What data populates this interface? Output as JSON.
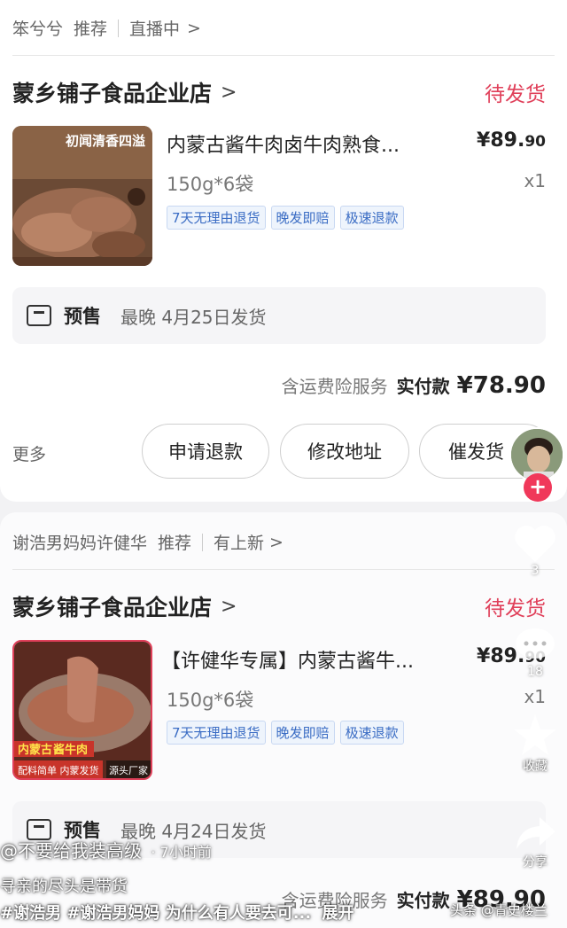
{
  "order1": {
    "source": {
      "author": "笨兮兮",
      "tag": "推荐",
      "live": "直播中",
      "chevron": ">"
    },
    "shop": {
      "name": "蒙乡铺子食品企业店",
      "chevron": ">",
      "status": "待发货"
    },
    "product": {
      "thumb_text": "初闻清香四溢",
      "name": "内蒙古酱牛肉卤牛肉熟食...",
      "price_main": "¥89.",
      "price_cents": "90",
      "spec": "150g*6袋",
      "qty": "x1",
      "tags": [
        "7天无理由退货",
        "晚发即赔",
        "极速退款"
      ]
    },
    "presale": {
      "title": "预售",
      "desc": "最晚 4月25日发货"
    },
    "total": {
      "insurance": "含运费险服务",
      "paid_label": "实付款",
      "amount": "¥78.90"
    },
    "actions": {
      "more": "更多",
      "refund": "申请退款",
      "edit_address": "修改地址",
      "urge": "催发货"
    }
  },
  "order2": {
    "source": {
      "author": "谢浩男妈妈许健华",
      "tag": "推荐",
      "new": "有上新",
      "chevron": ">"
    },
    "shop": {
      "name": "蒙乡铺子食品企业店",
      "chevron": ">",
      "status": "待发货"
    },
    "product": {
      "thumb_text_1": "内蒙古",
      "thumb_text_2": "酱牛肉",
      "thumb_text_3": "配料简单 内蒙发货",
      "thumb_text_4": "源头厂家",
      "name": "【许健华专属】内蒙古酱牛...",
      "price_main": "¥89.",
      "price_cents": "90",
      "spec": "150g*6袋",
      "qty": "x1",
      "tags": [
        "7天无理由退货",
        "晚发即赔",
        "极速退款"
      ]
    },
    "presale": {
      "title": "预售",
      "desc": "最晚 4月24日发货"
    },
    "total": {
      "insurance": "含运费险服务",
      "paid_label": "实付款",
      "amount": "¥89.90"
    }
  },
  "sidebar": {
    "like_count": "3",
    "comment_count": "18",
    "favorite_label": "收藏",
    "share_label": "分享"
  },
  "video_overlay": {
    "author": "@不要给我装高级",
    "time": "· 7小时前",
    "caption": "寻亲的尽头是带货",
    "hashtags": "#谢浩男 #谢浩男妈妈 为什么有人要去可...",
    "expand": "展开",
    "watermark": "头条 @青史楼兰"
  },
  "colors": {
    "accent": "#e0405a",
    "tag_blue": "#3a6cc4"
  }
}
